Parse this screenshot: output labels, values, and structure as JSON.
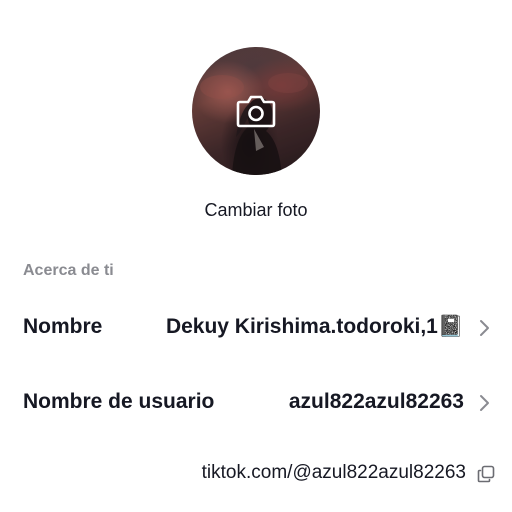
{
  "profile": {
    "change_photo_label": "Cambiar foto"
  },
  "about": {
    "section_title": "Acerca de ti",
    "name_label": "Nombre",
    "name_value": "Dekuy Kirishima.todoroki,1📓",
    "username_label": "Nombre de usuario",
    "username_value": "azul822azul82263",
    "profile_link": "tiktok.com/@azul822azul82263"
  },
  "icons": {
    "avatar_camera": "camera-icon",
    "row_chevron": "chevron-right-icon",
    "copy": "copy-icon"
  },
  "colors": {
    "text_primary": "#161823",
    "text_secondary": "#8a8b91",
    "icon_gray": "#8a8b91"
  }
}
